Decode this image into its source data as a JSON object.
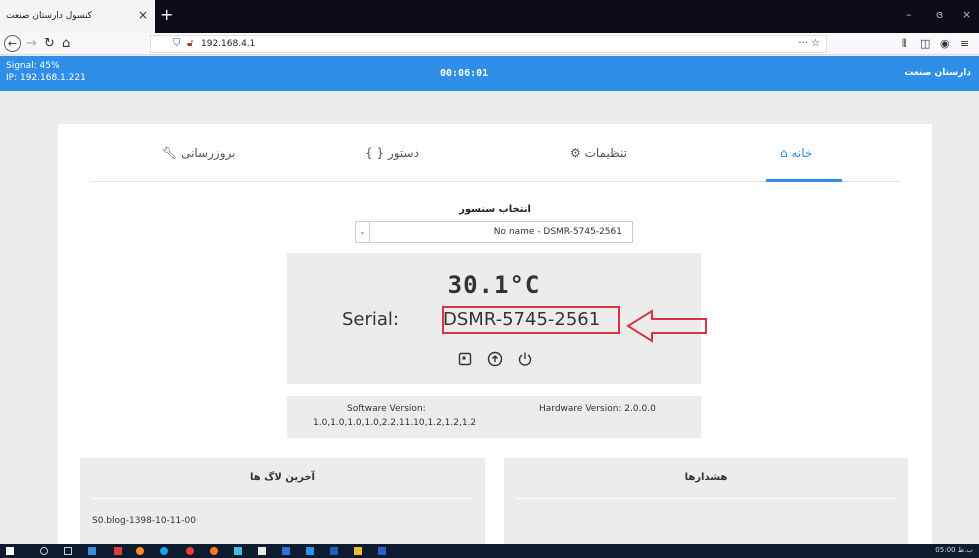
{
  "browser": {
    "tab_title": "کنسول دارستان صنعت",
    "tab_close": "×",
    "new_tab": "+",
    "url": "192.168.4.1",
    "url_actions": "··· ☆",
    "win_min": "–",
    "win_max": "ɞ",
    "win_close": "×"
  },
  "app_header": {
    "signal": "Signal: 45%",
    "ip": "IP: 192.168.1.221",
    "clock": "00:06:01",
    "brand": "دارستان صنعت"
  },
  "tabs": [
    {
      "label": "خانه",
      "icon": "home-icon"
    },
    {
      "label": "تنظیمات",
      "icon": "gear-icon"
    },
    {
      "label": "{ } دستور",
      "icon": "code-icon"
    },
    {
      "label": "بروزرسانی",
      "icon": "wrench-icon"
    }
  ],
  "sensor": {
    "title": "انتخاب سنسور",
    "selected": "No name - DSMR-5745-2561",
    "arrow": "⌄"
  },
  "reading": {
    "temperature": "30.1°C",
    "serial_label": "Serial:",
    "serial_value": "DSMR-5745-2561"
  },
  "versions": {
    "software_label": "Software Version:",
    "software_value": "1.0,1.0,1.0,1.0,2.2.11.10,1.2,1.2,1.2",
    "hardware": "Hardware Version: 2.0.0.0"
  },
  "panels": {
    "logs_title": "آخرین لاگ ها",
    "log_entry": "S0.blog-1398-10-11-00",
    "alerts_title": "هشدارها"
  },
  "taskbar": {
    "time": "05:00 ﺏ.ﻅ"
  },
  "colors": {
    "accent": "#2f8fe8",
    "highlight_red": "#d9333f"
  }
}
